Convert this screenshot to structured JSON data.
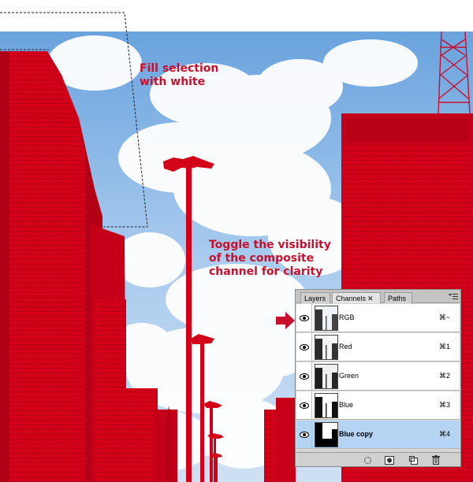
{
  "annotations": {
    "fill_selection": "Fill selection\nwith white",
    "toggle_visibility": "Toggle the visibility\nof the composite\nchannel for clarity"
  },
  "colors": {
    "accent_red": "#c8102e",
    "sky": "#9dc2ea",
    "selected_row": "#b5d3f3"
  },
  "panel": {
    "tabs": [
      {
        "label": "Layers"
      },
      {
        "label": "Channels",
        "close": "✕"
      },
      {
        "label": "Paths"
      }
    ],
    "menu_icon": "panel-menu-icon",
    "channels": [
      {
        "name": "RGB",
        "shortcut": "⌘~"
      },
      {
        "name": "Red",
        "shortcut": "⌘1"
      },
      {
        "name": "Green",
        "shortcut": "⌘2"
      },
      {
        "name": "Blue",
        "shortcut": "⌘3"
      },
      {
        "name": "Blue copy",
        "shortcut": "⌘4",
        "selected": true
      }
    ],
    "footer_icons": [
      "load-channel-as-selection-icon",
      "save-selection-as-channel-icon",
      "new-channel-icon",
      "delete-channel-icon"
    ]
  }
}
